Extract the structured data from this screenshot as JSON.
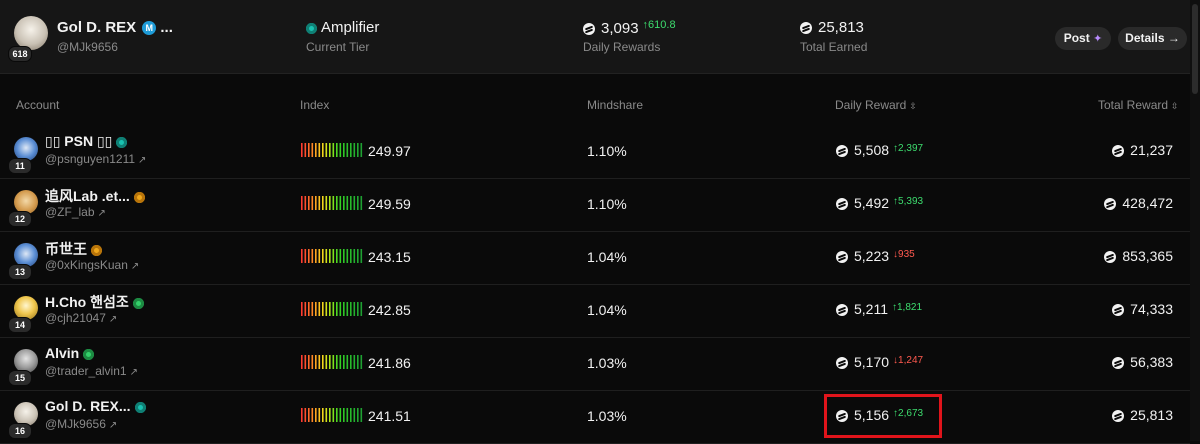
{
  "profile": {
    "name": "Gol D. REX",
    "name_suffix": "...",
    "verified_letter": "M",
    "handle": "@MJk9656",
    "rank": "618",
    "tier": "Amplifier",
    "tier_label": "Current Tier",
    "daily_rewards": "3,093",
    "daily_change": "610.8",
    "daily_label": "Daily Rewards",
    "total_earned": "25,813",
    "total_label": "Total Earned",
    "post_label": "Post",
    "details_label": "Details →"
  },
  "columns": {
    "account": "Account",
    "index": "Index",
    "mindshare": "Mindshare",
    "daily_reward": "Daily Reward",
    "total_reward": "Total Reward"
  },
  "rows": [
    {
      "rank": "11",
      "name": "▯▯ PSN ▯▯",
      "handle": "@psnguyen1211",
      "badge": "teal",
      "index": "249.97",
      "mindshare": "1.10%",
      "daily": "5,508",
      "change": "2,397",
      "change_dir": "up",
      "total": "21,237"
    },
    {
      "rank": "12",
      "name": "追风Lab .et...",
      "handle": "@ZF_lab",
      "badge": "gold",
      "index": "249.59",
      "mindshare": "1.10%",
      "daily": "5,492",
      "change": "5,393",
      "change_dir": "up",
      "total": "428,472"
    },
    {
      "rank": "13",
      "name": "币世王",
      "handle": "@0xKingsKuan",
      "badge": "gold",
      "index": "243.15",
      "mindshare": "1.04%",
      "daily": "5,223",
      "change": "-935",
      "change_dir": "down",
      "total": "853,365"
    },
    {
      "rank": "14",
      "name": "H.Cho 핸섬조",
      "handle": "@cjh21047",
      "badge": "green",
      "index": "242.85",
      "mindshare": "1.04%",
      "daily": "5,211",
      "change": "1,821",
      "change_dir": "up",
      "total": "74,333"
    },
    {
      "rank": "15",
      "name": "Alvin",
      "handle": "@trader_alvin1",
      "badge": "green",
      "index": "241.86",
      "mindshare": "1.03%",
      "daily": "5,170",
      "change": "-1,247",
      "change_dir": "down",
      "total": "56,383"
    },
    {
      "rank": "16",
      "name": "Gol D. REX...",
      "handle": "@MJk9656",
      "badge": "teal",
      "index": "241.51",
      "mindshare": "1.03%",
      "daily": "5,156",
      "change": "2,673",
      "change_dir": "up",
      "total": "25,813"
    }
  ],
  "colors": {
    "up": "#3ddc6e",
    "down": "#ff5a4f",
    "highlight": "#e0141b",
    "background": "#0a0a0a"
  }
}
